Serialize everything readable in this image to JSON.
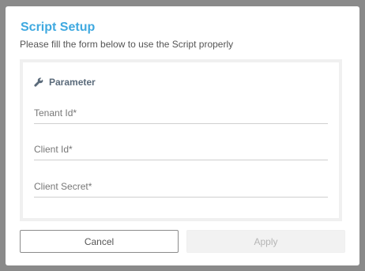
{
  "dialog": {
    "title": "Script Setup",
    "subtitle": "Please fill the form below to use the Script properly"
  },
  "parameters": {
    "heading": "Parameter",
    "icon": "wrench-icon",
    "fields": [
      {
        "name": "tenant-id",
        "placeholder": "Tenant Id*",
        "value": ""
      },
      {
        "name": "client-id",
        "placeholder": "Client Id*",
        "value": ""
      },
      {
        "name": "client-secret",
        "placeholder": "Client Secret*",
        "value": ""
      }
    ]
  },
  "actions": {
    "cancel_label": "Cancel",
    "apply_label": "Apply",
    "apply_enabled": false
  },
  "colors": {
    "title": "#3fa9e0",
    "heading": "#5a6a7a",
    "panel_border": "#f0f0f0",
    "apply_disabled_bg": "#f2f2f2"
  }
}
